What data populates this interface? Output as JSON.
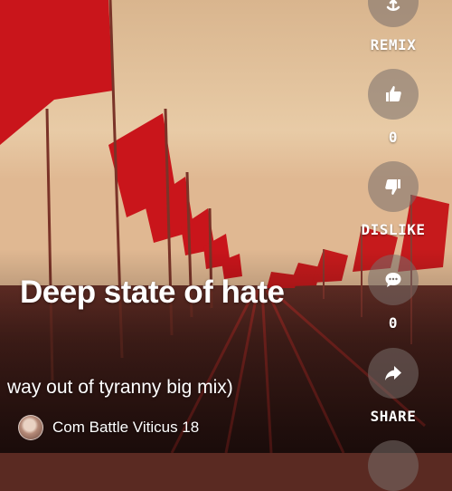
{
  "video": {
    "title": "Deep state of hate",
    "subtitle": "way out of tyranny big mix)",
    "channel": {
      "name": "Com Battle Viticus 18"
    }
  },
  "actions": {
    "remix": {
      "label": "REMIX",
      "icon": "remix-icon"
    },
    "like": {
      "count": "0",
      "icon": "thumbs-up-icon"
    },
    "dislike": {
      "label": "DISLIKE",
      "icon": "thumbs-down-icon"
    },
    "comments": {
      "count": "0",
      "icon": "comment-icon"
    },
    "share": {
      "label": "SHARE",
      "icon": "share-icon"
    }
  },
  "colors": {
    "flag_red": "#c8161d",
    "sky": "#e8c9a6",
    "button_bg": "#786e69"
  }
}
